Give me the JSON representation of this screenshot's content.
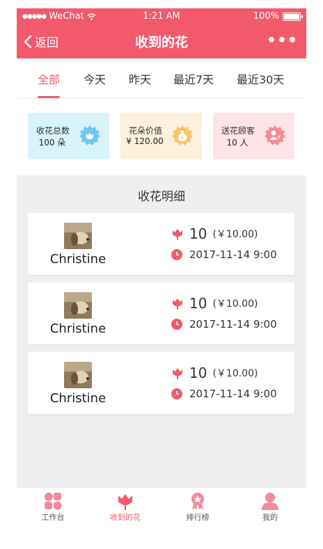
{
  "status_bar": {
    "carrier": "WeChat",
    "time": "1:21 AM",
    "battery": "100%"
  },
  "nav": {
    "back_label": "返回",
    "title": "收到的花",
    "more_label": "•••"
  },
  "tabs": [
    {
      "label": "全部",
      "active": true
    },
    {
      "label": "今天",
      "active": false
    },
    {
      "label": "昨天",
      "active": false
    },
    {
      "label": "最近7天",
      "active": false
    },
    {
      "label": "最近30天",
      "active": false
    }
  ],
  "stats": [
    {
      "label": "收花总数",
      "value": "100 朵",
      "icon": "flower-badge-icon",
      "color": "#6fc9ef"
    },
    {
      "label": "花朵价值",
      "value": "¥ 120.00",
      "icon": "money-bag-badge-icon",
      "color": "#f7c46d"
    },
    {
      "label": "送花顾客",
      "value": "10 人",
      "icon": "customer-badge-icon",
      "color": "#f48a9a"
    }
  ],
  "detail": {
    "title": "收花明细",
    "records": [
      {
        "name": "Christine",
        "count": "10",
        "price": "(￥10.00)",
        "time": "2017-11-14 9:00"
      },
      {
        "name": "Christine",
        "count": "10",
        "price": "(￥10.00)",
        "time": "2017-11-14 9:00"
      },
      {
        "name": "Christine",
        "count": "10",
        "price": "(￥10.00)",
        "time": "2017-11-14 9:00"
      }
    ]
  },
  "tabbar": [
    {
      "label": "工作台",
      "icon": "workbench-icon",
      "active": false
    },
    {
      "label": "收到的花",
      "icon": "flower-icon",
      "active": true
    },
    {
      "label": "排行榜",
      "icon": "ranking-medal-icon",
      "active": false
    },
    {
      "label": "我的",
      "icon": "profile-icon",
      "active": false
    }
  ],
  "colors": {
    "accent": "#f25a6b",
    "background": "#efefef",
    "card": "#ffffff"
  }
}
